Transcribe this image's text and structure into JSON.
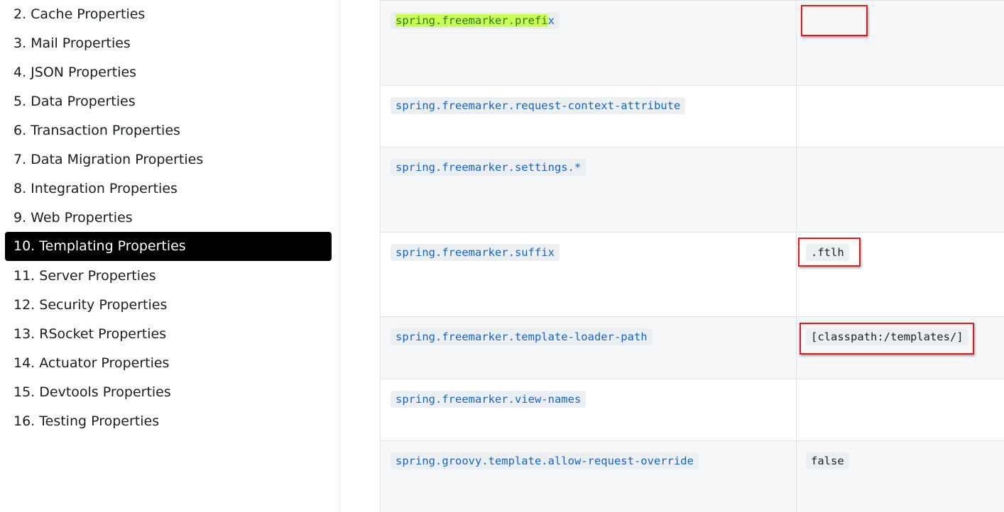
{
  "sidebar": {
    "items": [
      {
        "label": "2. Cache Properties"
      },
      {
        "label": "3. Mail Properties"
      },
      {
        "label": "4. JSON Properties"
      },
      {
        "label": "5. Data Properties"
      },
      {
        "label": "6. Transaction Properties"
      },
      {
        "label": "7. Data Migration Properties"
      },
      {
        "label": "8. Integration Properties"
      },
      {
        "label": "9. Web Properties"
      },
      {
        "label": "10. Templating Properties",
        "active": true
      },
      {
        "label": "11. Server Properties"
      },
      {
        "label": "12. Security Properties"
      },
      {
        "label": "13. RSocket Properties"
      },
      {
        "label": "14. Actuator Properties"
      },
      {
        "label": "15. Devtools Properties"
      },
      {
        "label": "16. Testing Properties"
      }
    ]
  },
  "table": {
    "rows": [
      {
        "name_highlighted": "spring.freemarker.prefi",
        "name_rest": "x",
        "default": ""
      },
      {
        "name": "spring.freemarker.request-context-attribute",
        "default": ""
      },
      {
        "name": "spring.freemarker.settings.*",
        "default": ""
      },
      {
        "name": "spring.freemarker.suffix",
        "default": ".ftlh"
      },
      {
        "name": "spring.freemarker.template-loader-path",
        "default": "[classpath:/templates/]"
      },
      {
        "name": "spring.freemarker.view-names",
        "default": ""
      },
      {
        "name": "spring.groovy.template.allow-request-override",
        "default": "false"
      }
    ]
  },
  "colors": {
    "active_nav_bg": "#000000",
    "property_text": "#1565c0",
    "highlight": "#ccff55",
    "annotation_box": "#e0181c"
  }
}
